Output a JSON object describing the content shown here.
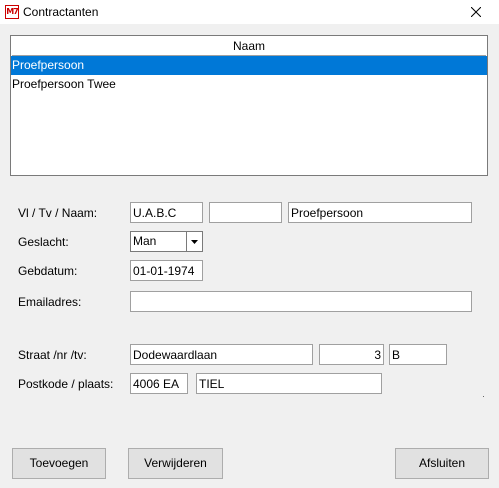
{
  "window": {
    "title": "Contractanten",
    "icon": "app-logo-icon",
    "icon_text": "M7"
  },
  "list": {
    "header": "Naam",
    "items": [
      {
        "label": "Proefpersoon",
        "selected": true
      },
      {
        "label": "Proefpersoon Twee",
        "selected": false
      }
    ],
    "selection_color": "#0078d7"
  },
  "form": {
    "name_label": "Vl / Tv / Naam:",
    "initials": "U.A.B.C",
    "prefix": "",
    "lastname": "Proefpersoon",
    "gender_label": "Geslacht:",
    "gender_value": "Man",
    "birthdate_label": "Gebdatum:",
    "birthdate": "01-01-1974",
    "email_label": "Emailadres:",
    "email": "",
    "street_label": "Straat /nr /tv:",
    "street": "Dodewaardlaan",
    "house_number": "3",
    "house_addition": "B",
    "postal_label": "Postkode / plaats:",
    "postal_code": "4006 EA",
    "city": "TIEL"
  },
  "buttons": {
    "add": "Toevoegen",
    "delete": "Verwijderen",
    "close": "Afsluiten"
  }
}
